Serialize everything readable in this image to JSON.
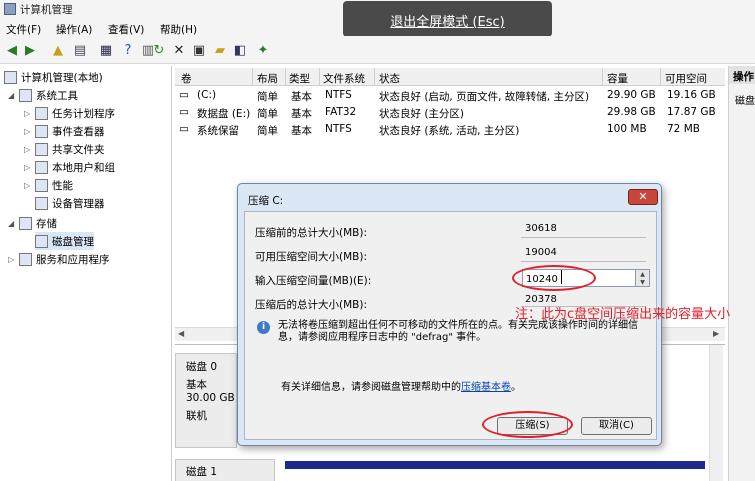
{
  "window": {
    "title": "计算机管理"
  },
  "menu": [
    "文件(F)",
    "操作(A)",
    "查看(V)",
    "帮助(H)"
  ],
  "fullscreen": {
    "label": "退出全屏模式 (Esc)"
  },
  "tree": {
    "items": [
      {
        "label": "计算机管理(本地)",
        "level": 0
      },
      {
        "label": "系统工具",
        "level": 1
      },
      {
        "label": "任务计划程序",
        "level": 2
      },
      {
        "label": "事件查看器",
        "level": 2
      },
      {
        "label": "共享文件夹",
        "level": 2
      },
      {
        "label": "本地用户和组",
        "level": 2
      },
      {
        "label": "性能",
        "level": 2
      },
      {
        "label": "设备管理器",
        "level": 2
      },
      {
        "label": "存储",
        "level": 1
      },
      {
        "label": "磁盘管理",
        "level": 2
      },
      {
        "label": "服务和应用程序",
        "level": 1
      }
    ]
  },
  "volumes": {
    "columns": [
      "卷",
      "布局",
      "类型",
      "文件系统",
      "状态",
      "容量",
      "可用空间"
    ],
    "rows": [
      [
        "(C:)",
        "简单",
        "基本",
        "NTFS",
        "状态良好 (启动, 页面文件, 故障转储, 主分区)",
        "29.90 GB",
        "19.16 GB"
      ],
      [
        "数据盘 (E:)",
        "简单",
        "基本",
        "FAT32",
        "状态良好 (主分区)",
        "29.98 GB",
        "17.87 GB"
      ],
      [
        "系统保留",
        "简单",
        "基本",
        "NTFS",
        "状态良好 (系统, 活动, 主分区)",
        "100 MB",
        "72 MB"
      ]
    ]
  },
  "actions": {
    "header": "操作",
    "sub": "磁盘"
  },
  "disks": {
    "disk0": {
      "name": "磁盘 0",
      "type": "基本",
      "size": "30.00 GB",
      "status": "联机"
    },
    "disk1": {
      "name": "磁盘 1"
    }
  },
  "dialog": {
    "title": "压缩 C:",
    "close": "✕",
    "total_before_label": "压缩前的总计大小(MB):",
    "total_before_value": "30618",
    "available_label": "可用压缩空间大小(MB):",
    "available_value": "19004",
    "input_label": "输入压缩空间量(MB)(E):",
    "input_value": "10240",
    "total_after_label": "压缩后的总计大小(MB):",
    "total_after_value": "20378",
    "info": "无法将卷压缩到超出任何不可移动的文件所在的点。有关完成该操作时间的详细信息，请参阅应用程序日志中的 \"defrag\" 事件。",
    "help_prefix": "有关详细信息，请参阅磁盘管理帮助中的",
    "help_link": "压缩基本卷",
    "help_suffix": "。",
    "shrink_button": "压缩(S)",
    "cancel_button": "取消(C)"
  },
  "annotation": {
    "note": "注：此为c盘空间压缩出来的容量大小",
    "color": "#e0202a"
  }
}
